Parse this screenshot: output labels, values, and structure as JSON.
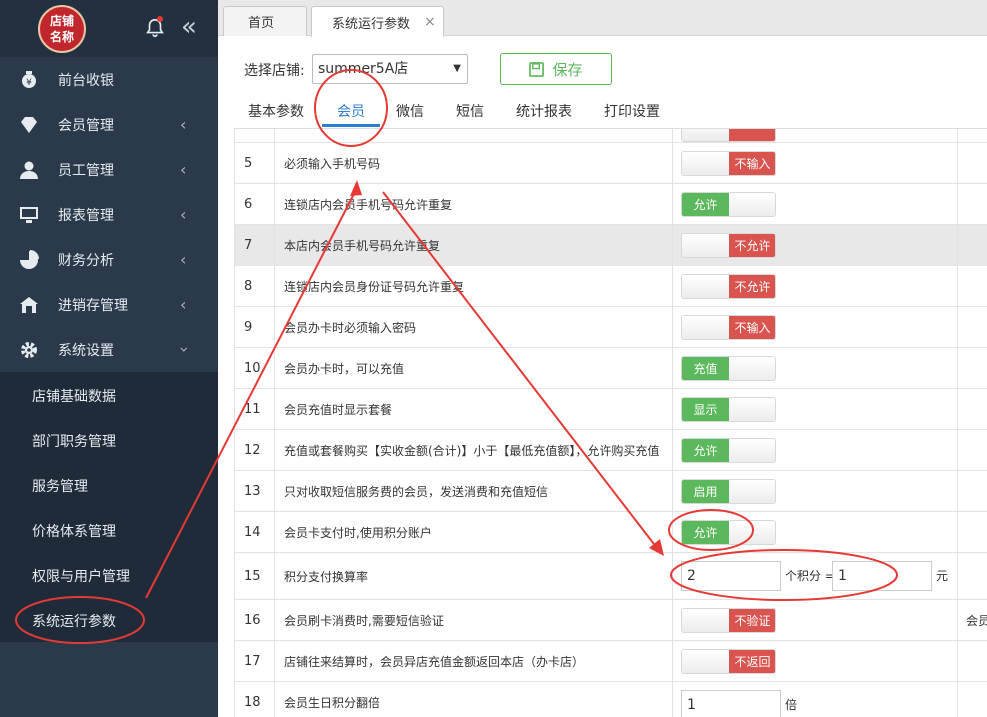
{
  "sidebar": {
    "logo_line1": "店铺",
    "logo_line2": "名称",
    "items": [
      {
        "label": "前台收银",
        "icon": "money-bag-icon"
      },
      {
        "label": "会员管理",
        "icon": "diamond-icon"
      },
      {
        "label": "员工管理",
        "icon": "user-icon"
      },
      {
        "label": "报表管理",
        "icon": "monitor-icon"
      },
      {
        "label": "财务分析",
        "icon": "pie-chart-icon"
      },
      {
        "label": "进销存管理",
        "icon": "warehouse-icon"
      },
      {
        "label": "系统设置",
        "icon": "gear-icon"
      }
    ],
    "subitems": [
      "店铺基础数据",
      "部门职务管理",
      "服务管理",
      "价格体系管理",
      "权限与用户管理",
      "系统运行参数"
    ]
  },
  "tabs": {
    "home": "首页",
    "current": "系统运行参数",
    "close": "×"
  },
  "store": {
    "label": "选择店铺:",
    "selected": "summer5A店",
    "save_label": "保存"
  },
  "subtabs": [
    "基本参数",
    "会员",
    "微信",
    "短信",
    "统计报表",
    "打印设置"
  ],
  "rows": [
    {
      "no": "5",
      "desc": "必须输入手机号码",
      "state": "off",
      "text": "不输入"
    },
    {
      "no": "6",
      "desc": "连锁店内会员手机号码允许重复",
      "state": "on",
      "text": "允许"
    },
    {
      "no": "7",
      "desc": "本店内会员手机号码允许重复",
      "state": "off",
      "text": "不允许"
    },
    {
      "no": "8",
      "desc": "连锁店内会员身份证号码允许重复",
      "state": "off",
      "text": "不允许"
    },
    {
      "no": "9",
      "desc": "会员办卡时必须输入密码",
      "state": "off",
      "text": "不输入"
    },
    {
      "no": "10",
      "desc": "会员办卡时，可以充值",
      "state": "on",
      "text": "充值"
    },
    {
      "no": "11",
      "desc": "会员充值时显示套餐",
      "state": "on",
      "text": "显示"
    },
    {
      "no": "12",
      "desc": "充值或套餐购买【实收金额(合计)】小于【最低充值额】，允许购买充值",
      "state": "on",
      "text": "允许"
    },
    {
      "no": "13",
      "desc": "只对收取短信服务费的会员，发送消费和充值短信",
      "state": "on",
      "text": "启用"
    },
    {
      "no": "14",
      "desc": "会员卡支付时,使用积分账户",
      "state": "on",
      "text": "允许"
    },
    {
      "no": "15",
      "desc": "积分支付换算率"
    },
    {
      "no": "16",
      "desc": "会员刷卡消费时,需要短信验证",
      "state": "off",
      "text": "不验证",
      "extra": "会员"
    },
    {
      "no": "17",
      "desc": "店铺往来结算时，会员异店充值金额返回本店（办卡店）",
      "state": "off",
      "text": "不返回"
    },
    {
      "no": "18",
      "desc": "会员生日积分翻倍"
    }
  ],
  "rate": {
    "points": "2",
    "mid_label": "个积分 =",
    "yuan": "1",
    "unit": "元"
  },
  "birthday": {
    "value": "1",
    "unit": "倍"
  },
  "colors": {
    "sidebar": "#2b3a4a",
    "on": "#5cb85c",
    "off": "#d9534f",
    "accent": "#2e7dd1",
    "annotation": "#e53935"
  }
}
